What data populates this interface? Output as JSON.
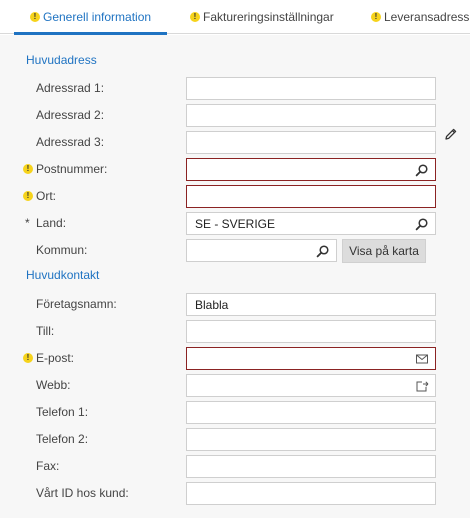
{
  "tabs": [
    {
      "label": "Generell information",
      "active": true,
      "warning": true
    },
    {
      "label": "Faktureringsinställningar",
      "active": false,
      "warning": true
    },
    {
      "label": "Leveransadress",
      "active": false,
      "warning": true
    }
  ],
  "sections": {
    "address_heading": "Huvudadress",
    "contact_heading": "Huvudkontakt"
  },
  "address": {
    "line1": {
      "label": "Adressrad 1:",
      "value": ""
    },
    "line2": {
      "label": "Adressrad 2:",
      "value": ""
    },
    "line3": {
      "label": "Adressrad 3:",
      "value": ""
    },
    "postal": {
      "label": "Postnummer:",
      "value": ""
    },
    "city": {
      "label": "Ort:",
      "value": ""
    },
    "country": {
      "label": "Land:",
      "value": "SE - SVERIGE",
      "required_marker": "*"
    },
    "municipality": {
      "label": "Kommun:",
      "value": ""
    },
    "map_button": "Visa på karta"
  },
  "contact": {
    "company": {
      "label": "Företagsnamn:",
      "value": "Blabla"
    },
    "attention": {
      "label": "Till:",
      "value": ""
    },
    "email": {
      "label": "E-post:",
      "value": ""
    },
    "web": {
      "label": "Webb:",
      "value": ""
    },
    "phone1": {
      "label": "Telefon 1:",
      "value": ""
    },
    "phone2": {
      "label": "Telefon 2:",
      "value": ""
    },
    "fax": {
      "label": "Fax:",
      "value": ""
    },
    "our_id": {
      "label": "Vårt ID hos kund:",
      "value": ""
    }
  },
  "icons": {
    "warning": "warning-icon",
    "lookup": "magnifier-icon",
    "edit": "pencil-icon",
    "mail": "envelope-icon",
    "web": "open-link-icon"
  },
  "colors": {
    "accent": "#1f73c2",
    "error_border": "#8b2323",
    "warning": "#f6d31b"
  }
}
